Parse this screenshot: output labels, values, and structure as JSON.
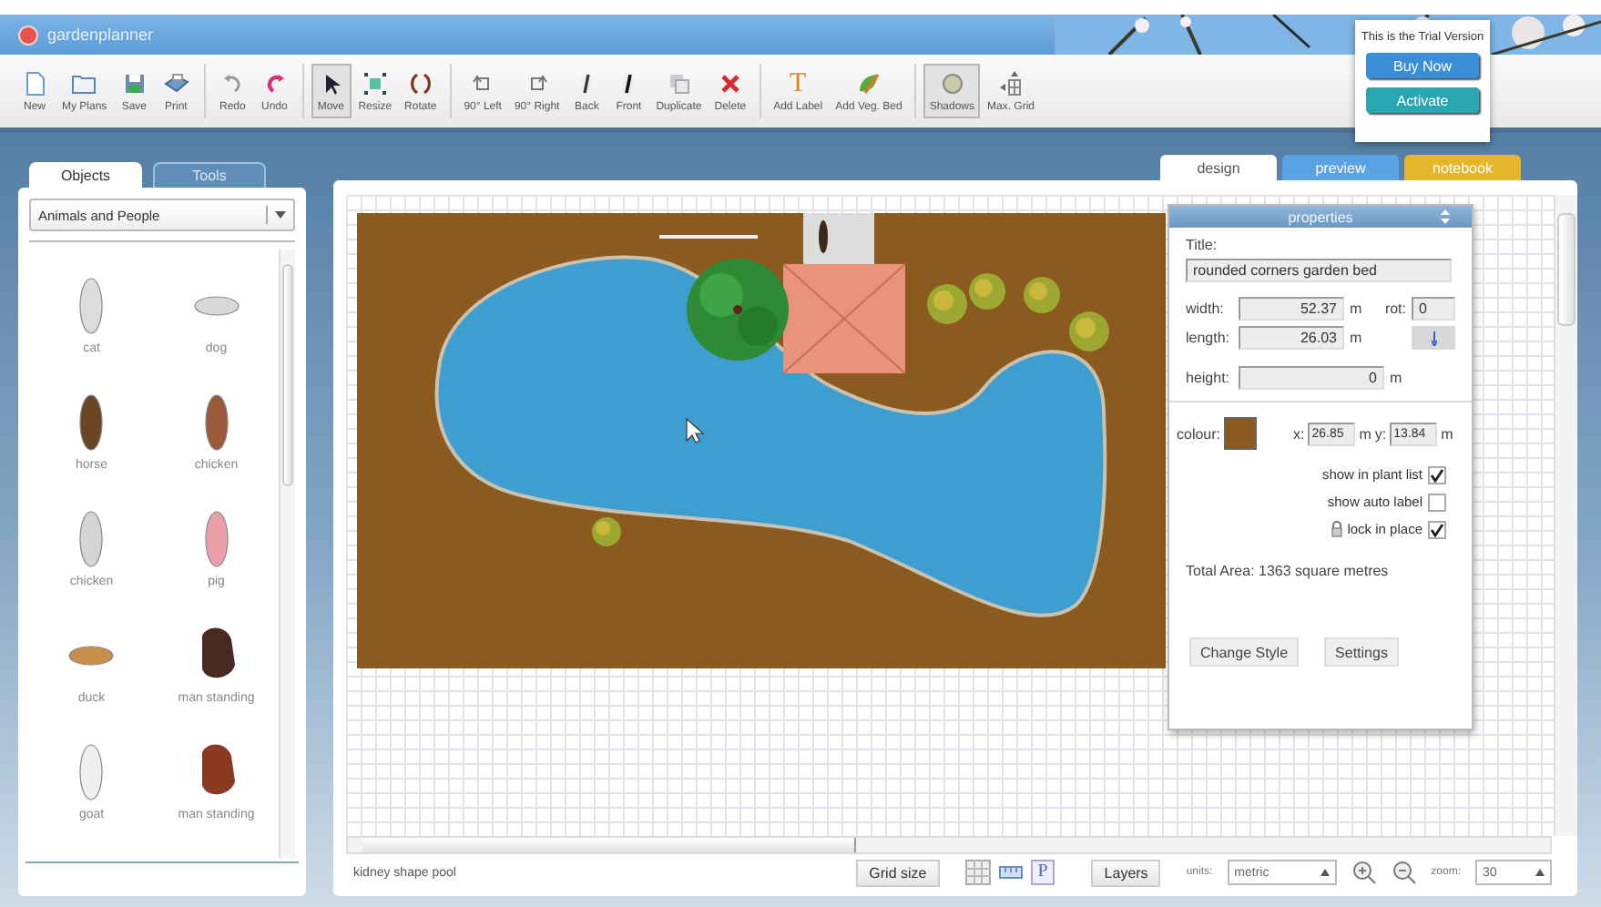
{
  "app": {
    "name": "gardenplanner"
  },
  "toolbar": [
    {
      "buttons": [
        {
          "label": "New",
          "selected": false
        },
        {
          "label": "My Plans",
          "selected": false
        },
        {
          "label": "Save",
          "selected": false
        },
        {
          "label": "Print",
          "selected": false
        }
      ]
    },
    {
      "buttons": [
        {
          "label": "Redo",
          "selected": false
        },
        {
          "label": "Undo",
          "selected": false
        }
      ]
    },
    {
      "buttons": [
        {
          "label": "Move",
          "selected": true
        },
        {
          "label": "Resize",
          "selected": false
        },
        {
          "label": "Rotate",
          "selected": false
        }
      ]
    },
    {
      "buttons": [
        {
          "label": "90° Left",
          "selected": false
        },
        {
          "label": "90° Right",
          "selected": false
        },
        {
          "label": "Back",
          "selected": false
        },
        {
          "label": "Front",
          "selected": false
        },
        {
          "label": "Duplicate",
          "selected": false
        },
        {
          "label": "Delete",
          "selected": false
        }
      ]
    },
    {
      "buttons": [
        {
          "label": "Add Label",
          "glyph": "T",
          "selected": false
        },
        {
          "label": "Add Veg. Bed",
          "selected": false
        }
      ]
    },
    {
      "buttons": [
        {
          "label": "Shadows",
          "selected": true
        },
        {
          "label": "Max. Grid",
          "selected": false
        }
      ]
    }
  ],
  "trial": {
    "message": "This is the Trial Version",
    "buttons": [
      {
        "label": "Buy Now",
        "color": "#3a8ed8"
      },
      {
        "label": "Activate",
        "color": "#2aa5b2"
      }
    ]
  },
  "sidebar": {
    "tabs": [
      {
        "label": "Objects",
        "selected": true
      },
      {
        "label": "Tools",
        "selected": false
      }
    ],
    "category": "Animals and People",
    "items": [
      {
        "label": "cat",
        "kind": "animal"
      },
      {
        "label": "dog",
        "kind": "animal"
      },
      {
        "label": "horse",
        "kind": "animal"
      },
      {
        "label": "chicken",
        "kind": "animal"
      },
      {
        "label": "chicken",
        "kind": "animal"
      },
      {
        "label": "pig",
        "kind": "animal"
      },
      {
        "label": "duck",
        "kind": "animal"
      },
      {
        "label": "man standing",
        "kind": "person"
      },
      {
        "label": "goat",
        "kind": "animal"
      },
      {
        "label": "man standing",
        "kind": "person"
      }
    ]
  },
  "view_tabs": [
    {
      "label": "design",
      "selected": true,
      "color": "#ffffff"
    },
    {
      "label": "preview",
      "selected": false,
      "color": "#5aa2e2"
    },
    {
      "label": "notebook",
      "selected": false,
      "color": "#e5b52c"
    }
  ],
  "properties": {
    "header": "properties",
    "title_label": "Title:",
    "title": "rounded corners garden bed",
    "width": {
      "label": "width:",
      "value": "52.37",
      "unit": "m"
    },
    "length": {
      "label": "length:",
      "value": "26.03",
      "unit": "m"
    },
    "rot": {
      "label": "rot:",
      "value": "0"
    },
    "height": {
      "label": "height:",
      "value": "0",
      "unit": "m"
    },
    "colour": {
      "label": "colour:",
      "color": "#8b5a1e"
    },
    "x": {
      "label": "x:",
      "value": "26.85",
      "unit": "m"
    },
    "y": {
      "label": "y:",
      "value": "13.84",
      "unit": "m"
    },
    "options": [
      {
        "label": "show in plant list",
        "checked": true,
        "kind": "plain"
      },
      {
        "label": "show auto label",
        "checked": false,
        "kind": "plain"
      },
      {
        "label": "lock in place",
        "checked": true,
        "kind": "lock"
      }
    ],
    "total": "Total Area: 1363 square metres",
    "buttons": [
      "Change Style",
      "Settings"
    ]
  },
  "status_bar": {
    "selection": "kidney shape pool",
    "grid_button": "Grid size",
    "view_buttons": [
      {
        "kind": "grid"
      },
      {
        "kind": "ruler"
      },
      {
        "kind": "text",
        "glyph": "P"
      }
    ],
    "layers_button": "Layers",
    "units_label": "units:",
    "units": "metric",
    "zoom_label": "zoom:",
    "zoom": "30"
  }
}
